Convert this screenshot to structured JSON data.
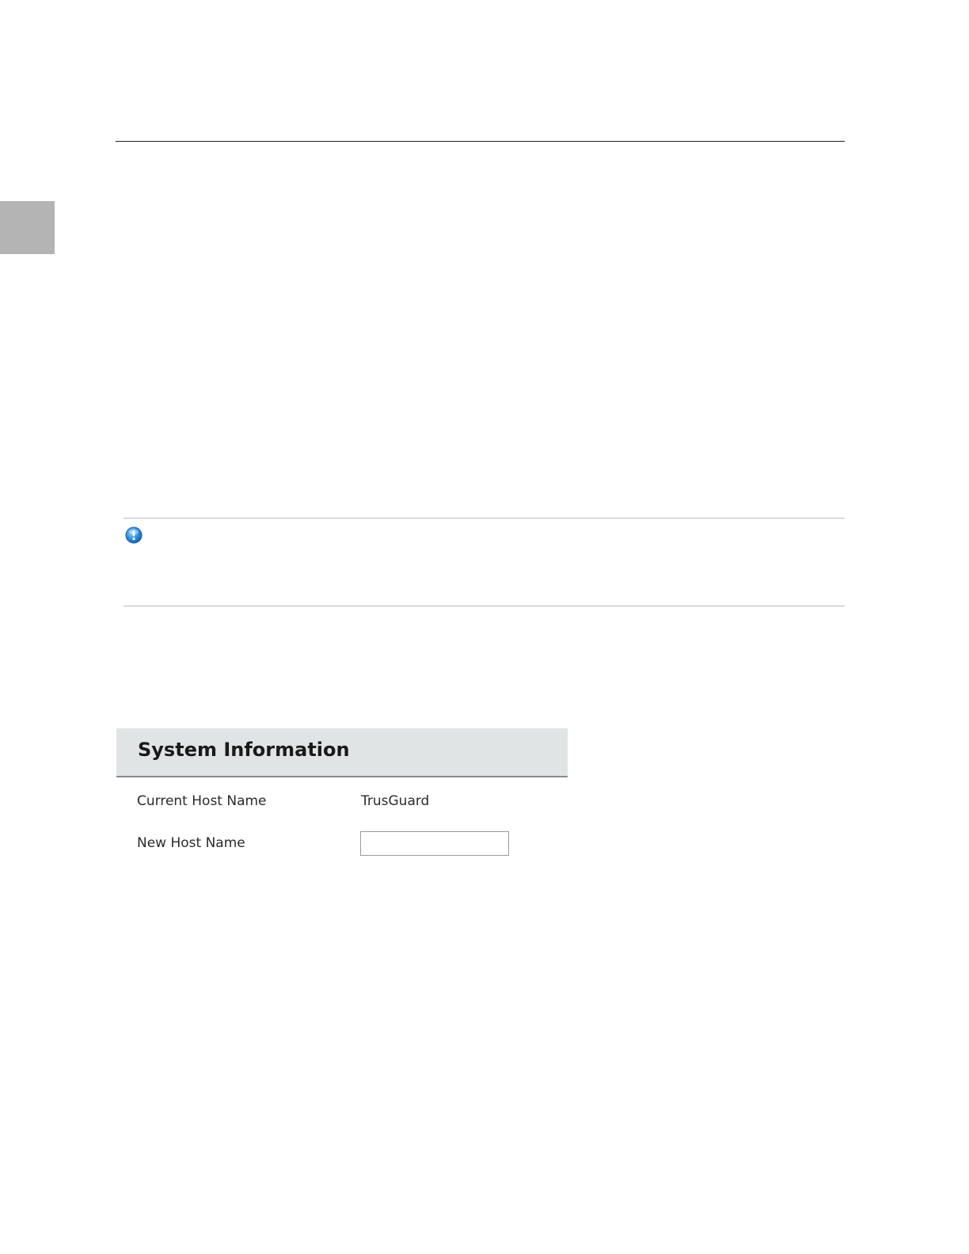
{
  "note": {
    "icon": "info-icon"
  },
  "system_information": {
    "title": "System Information",
    "current_host_name": {
      "label": "Current Host Name",
      "value": "TrusGuard"
    },
    "new_host_name": {
      "label": "New Host Name",
      "value": "",
      "placeholder": ""
    }
  },
  "colors": {
    "panel_header_bg": "#e1e4e5",
    "chapter_tab": "#b4b4b4",
    "info_icon": "#2d8fe0"
  }
}
